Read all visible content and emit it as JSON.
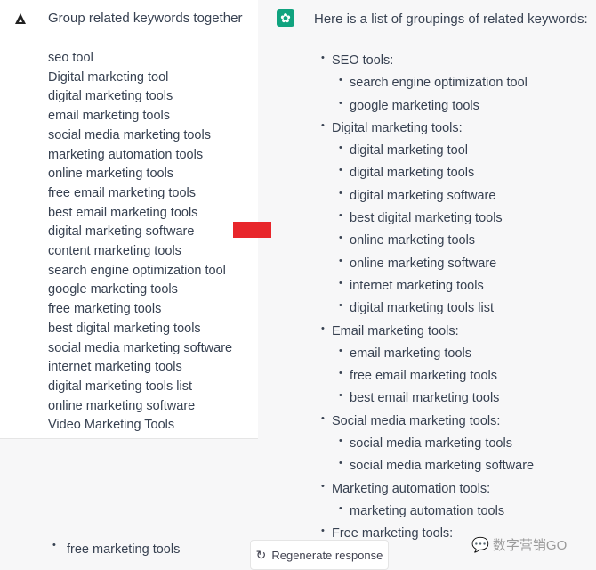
{
  "user": {
    "icon": "user-avatar-triangle-icon",
    "prompt": "Group related keywords together",
    "keywords": [
      "seo tool",
      "Digital marketing tool",
      "digital marketing tools",
      "email marketing tools",
      "social media marketing tools",
      "marketing automation tools",
      "online marketing tools",
      "free email marketing tools",
      "best email marketing tools",
      "digital marketing software",
      "content marketing tools",
      "search engine optimization tool",
      "google marketing tools",
      "free marketing tools",
      "best digital marketing tools",
      "social media marketing software",
      "internet marketing tools",
      "digital marketing tools list",
      "online marketing software",
      "Video Marketing Tools"
    ]
  },
  "assistant": {
    "icon": "openai-logo-icon",
    "title": "Here is a list of groupings of related keywords:",
    "groups": [
      {
        "label": "SEO tools:",
        "items": [
          "search engine optimization tool",
          "google marketing tools"
        ]
      },
      {
        "label": "Digital marketing tools:",
        "items": [
          "digital marketing tool",
          "digital marketing tools",
          "digital marketing software",
          "best digital marketing tools",
          "online marketing tools",
          "online marketing software",
          "internet marketing tools",
          "digital marketing tools list"
        ]
      },
      {
        "label": "Email marketing tools:",
        "items": [
          "email marketing tools",
          "free email marketing tools",
          "best email marketing tools"
        ]
      },
      {
        "label": "Social media marketing tools:",
        "items": [
          "social media marketing tools",
          "social media marketing software"
        ]
      },
      {
        "label": "Marketing automation tools:",
        "items": [
          "marketing automation tools"
        ]
      },
      {
        "label": "Free marketing tools:",
        "items": []
      }
    ]
  },
  "bottom": {
    "item": "free marketing tools",
    "regenerate_label": "Regenerate response"
  },
  "watermark": "数字营销GO",
  "colors": {
    "accent": "#10a37f",
    "arrow": "#e8262b"
  }
}
